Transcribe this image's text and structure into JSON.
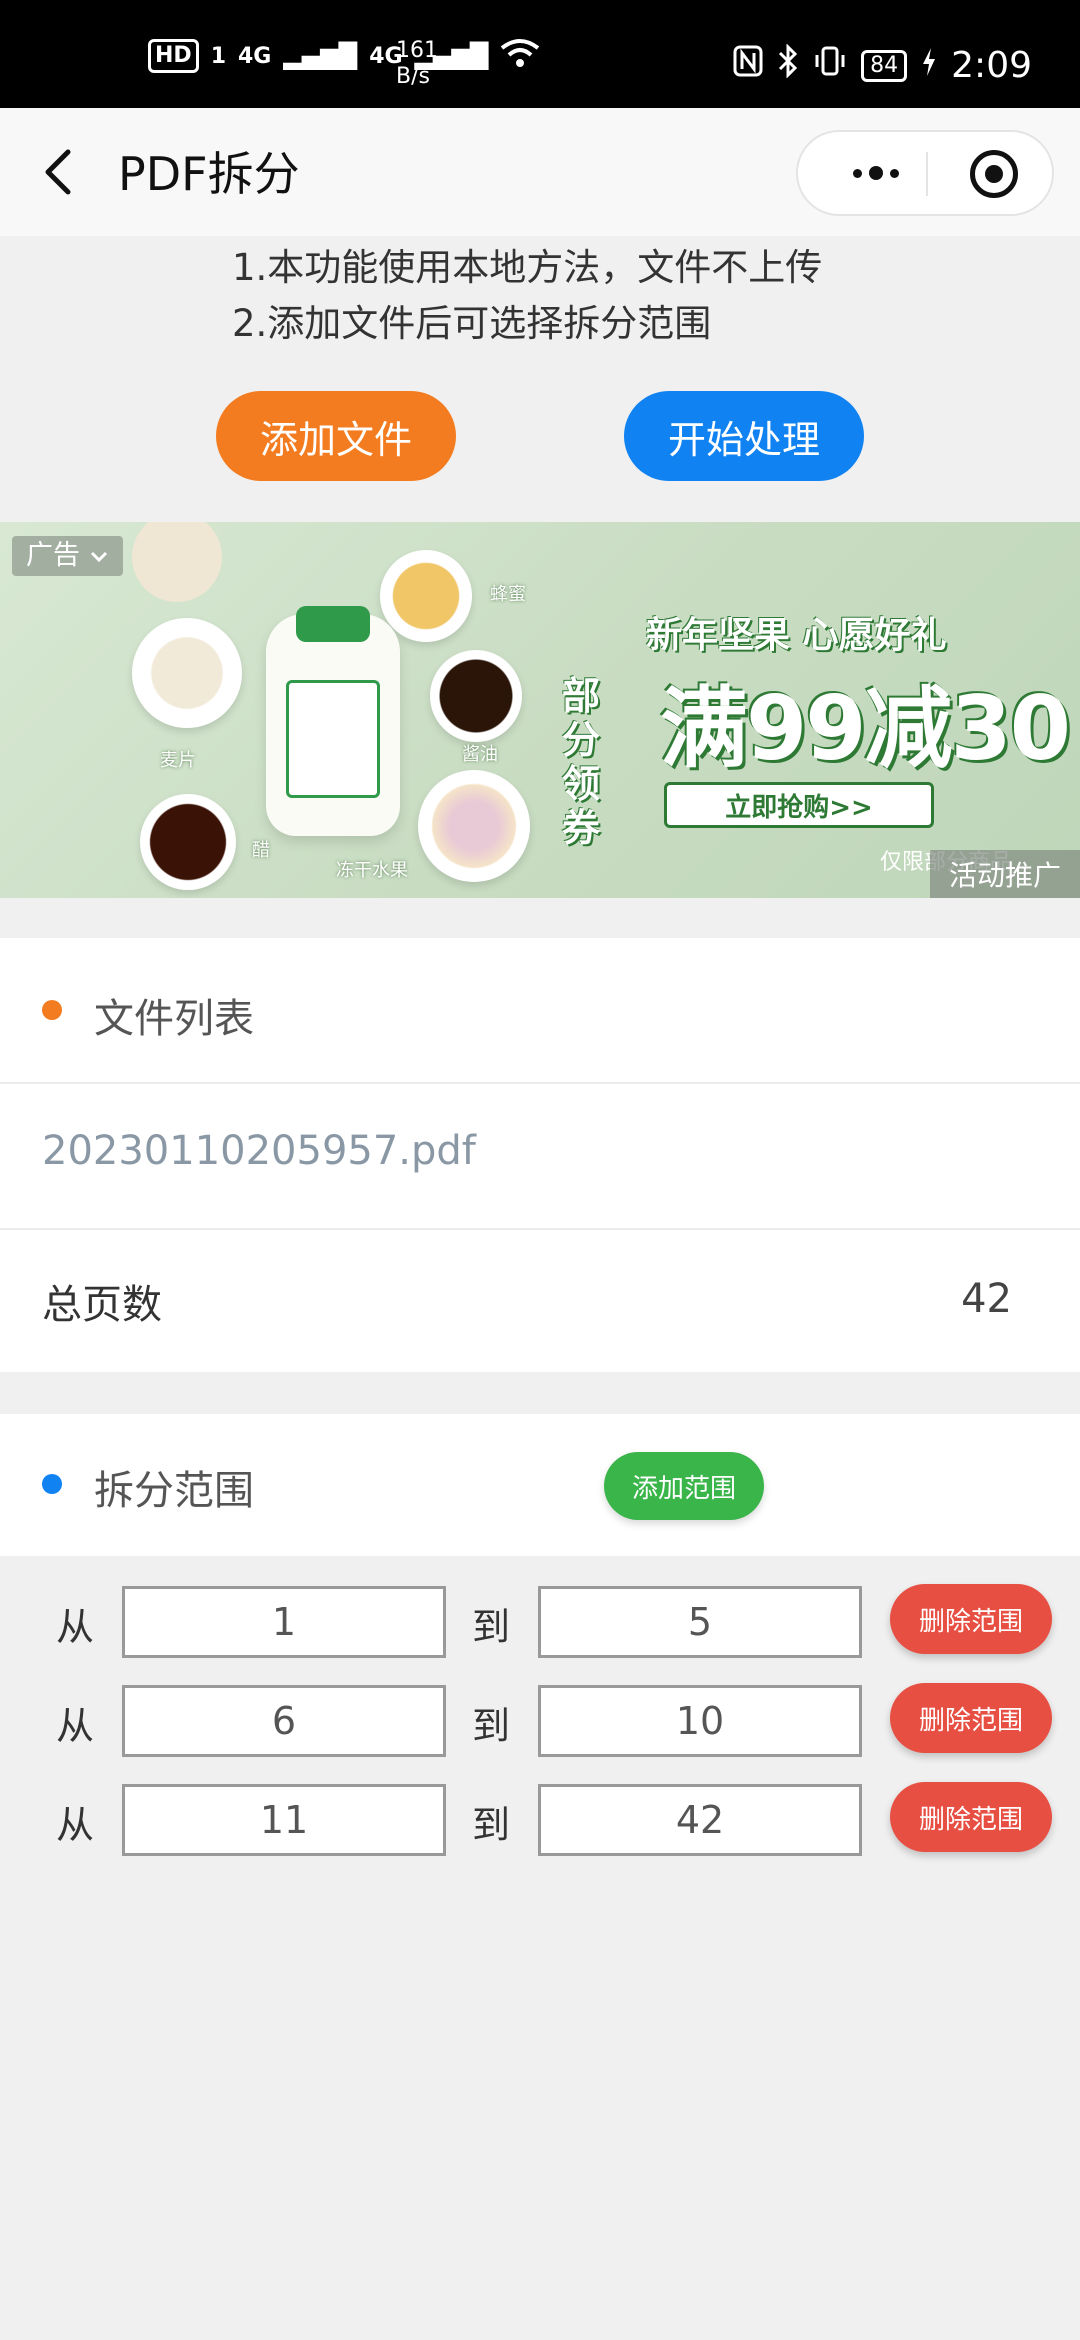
{
  "status_bar": {
    "hd": "HD",
    "sim": "1",
    "net1": "4G",
    "net2": "4G",
    "speed_value": "161",
    "speed_unit": "B/s",
    "battery": "84",
    "time": "2:09"
  },
  "nav": {
    "title": "PDF拆分"
  },
  "instructions": [
    "1.本功能使用本地方法，文件不上传",
    "2.添加文件后可选择拆分范围"
  ],
  "actions": {
    "add_file": "添加文件",
    "start": "开始处理"
  },
  "ad": {
    "tag": "广告",
    "headline": "新年坚果 心愿好礼",
    "coupon": "部分领券",
    "offer": "满99减30",
    "buy": "立即抢购>>",
    "limit_note": "仅限部分商品",
    "promo_label": "活动推广",
    "labels": {
      "oat": "麦片",
      "honey": "蜂蜜",
      "soy": "酱油",
      "vinegar": "醋",
      "fruit": "冻干水果"
    }
  },
  "files": {
    "title": "文件列表",
    "items": [
      "20230110205957.pdf"
    ],
    "total_pages_label": "总页数",
    "total_pages": "42"
  },
  "ranges": {
    "title": "拆分范围",
    "add_label": "添加范围",
    "from_label": "从",
    "to_label": "到",
    "delete_label": "删除范围",
    "rows": [
      {
        "from": "1",
        "to": "5"
      },
      {
        "from": "6",
        "to": "10"
      },
      {
        "from": "11",
        "to": "42"
      }
    ]
  },
  "colors": {
    "orange": "#f47c20",
    "blue": "#1082f2",
    "green": "#39b54a",
    "red": "#e84f43"
  }
}
